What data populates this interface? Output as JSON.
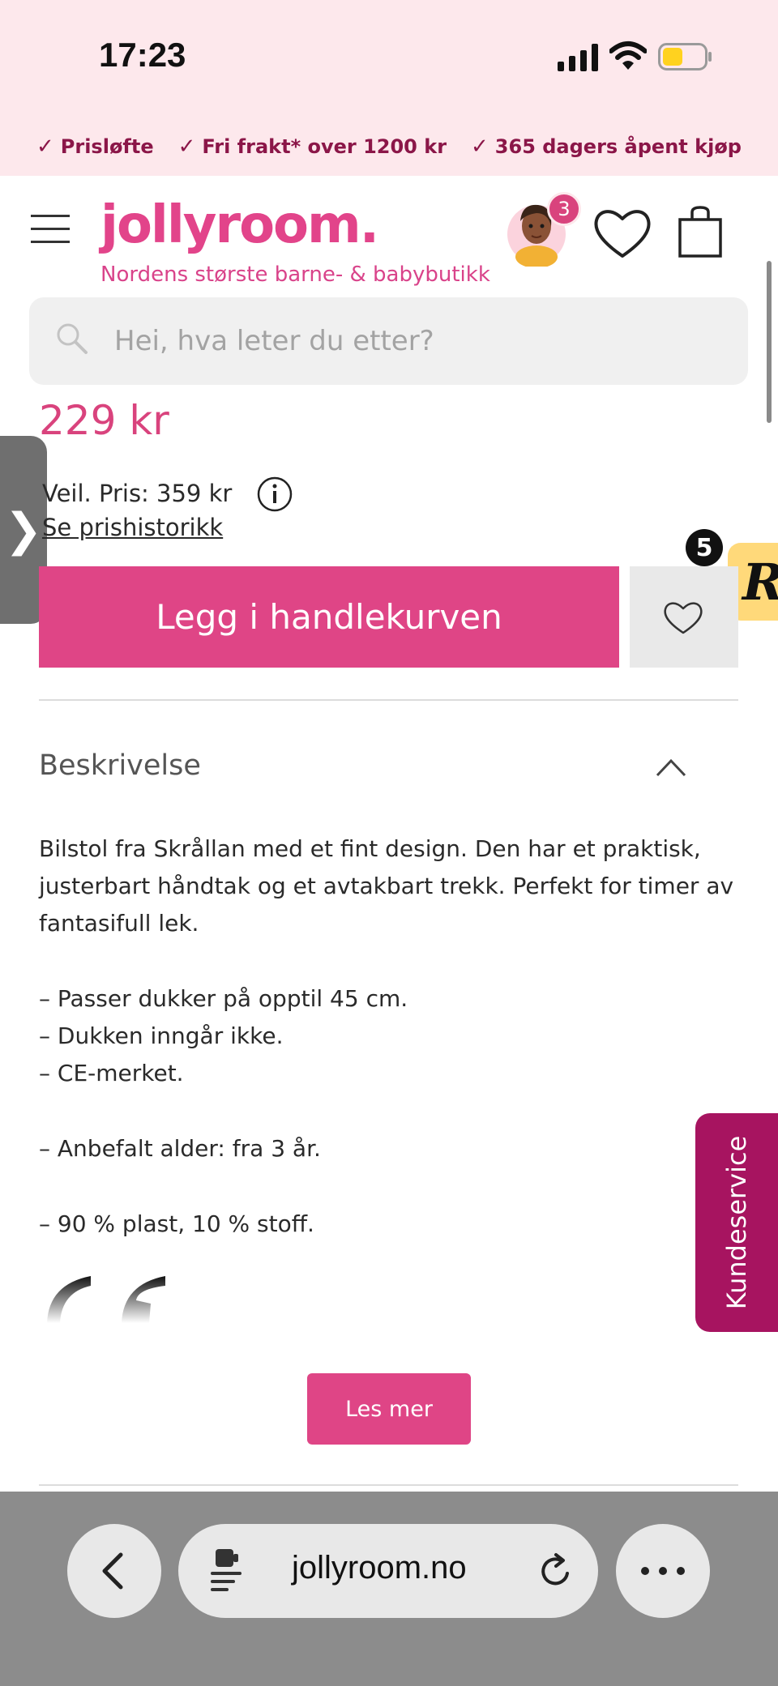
{
  "status_bar": {
    "time": "17:23"
  },
  "usp": [
    {
      "label": "Prisløfte"
    },
    {
      "label": "Fri frakt* over 1200 kr"
    },
    {
      "label": "365 dagers åpent kjøp"
    }
  ],
  "header": {
    "logo": "jollyroom.",
    "tagline": "Nordens største barne- & babybutikk",
    "avatar_badge": "3"
  },
  "search": {
    "placeholder": "Hei, hva leter du etter?"
  },
  "product": {
    "price": "229 kr",
    "recommended_price": "Veil. Pris: 359 kr",
    "price_history_link": "Se prishistorikk",
    "add_to_cart": "Legg i handlekurven"
  },
  "side_tab": {
    "glyph": "❯"
  },
  "r_badge": {
    "letter": "R",
    "count": "5"
  },
  "description": {
    "title": "Beskrivelse",
    "intro": "Bilstol fra Skrållan med et fint design. Den har et praktisk, justerbart håndtak og et avtakbart trekk. Perfekt for timer av fantasifull lek.",
    "bullets_group1": [
      "– Passer dukker på opptil 45 cm.",
      "– Dukken inngår ikke.",
      "– CE-merket."
    ],
    "bullet_age": "– Anbefalt alder: fra 3 år.",
    "bullet_material": "– 90 % plast, 10 % stoff.",
    "read_more": "Les mer"
  },
  "kundeservice": {
    "label": "Kundeservice"
  },
  "browser": {
    "url": "jollyroom.no"
  },
  "colors": {
    "brand_pink": "#df4586",
    "usp_text": "#8b1648",
    "top_bg": "#fde8ec",
    "kundeservice_bg": "#a71460"
  }
}
